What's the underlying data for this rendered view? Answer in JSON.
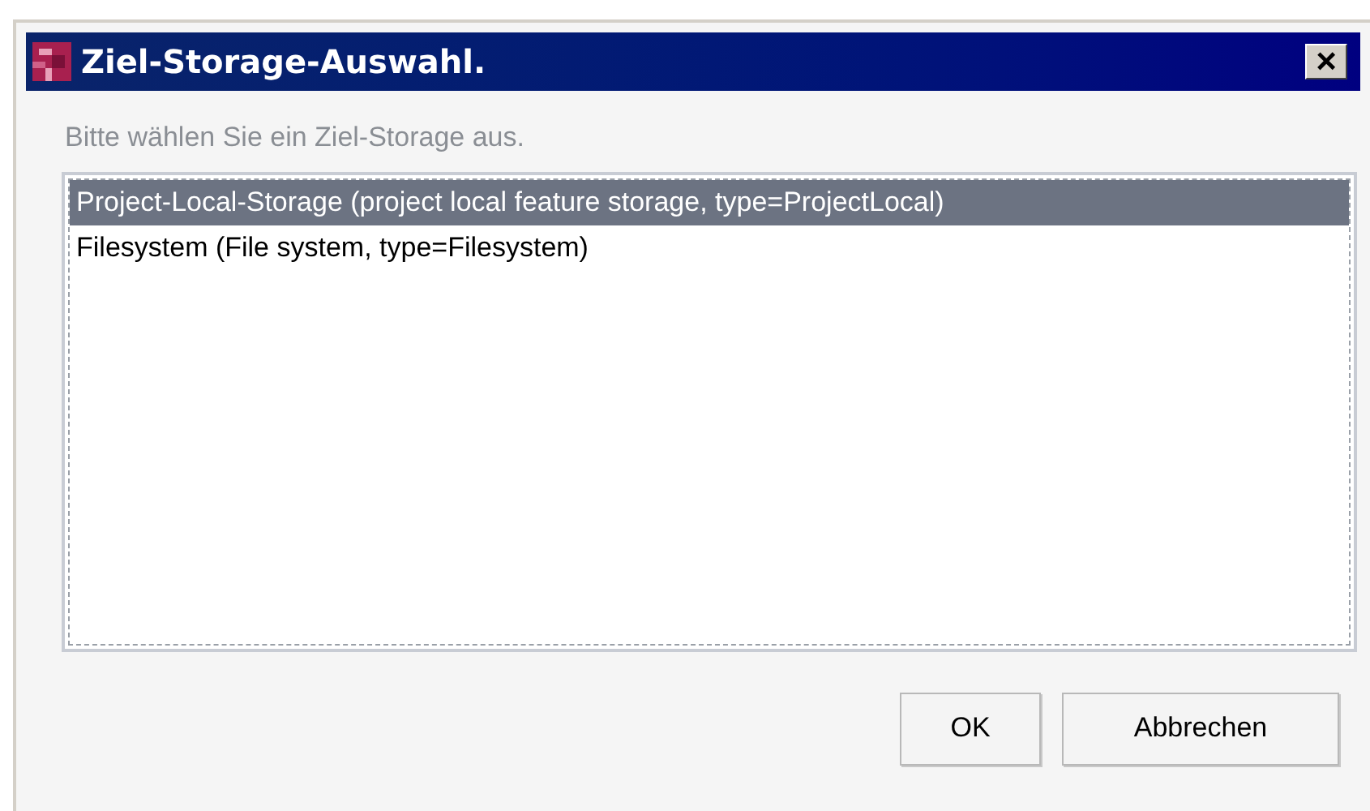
{
  "window": {
    "title": "Ziel-Storage-Auswahl.",
    "close": "×"
  },
  "prompt": "Bitte wählen Sie ein Ziel-Storage aus.",
  "items": [
    {
      "label": "Project-Local-Storage (project local feature storage, type=ProjectLocal)",
      "selected": true
    },
    {
      "label": "Filesystem (File system, type=Filesystem)",
      "selected": false
    }
  ],
  "buttons": [
    "OK",
    "Abbrechen"
  ]
}
